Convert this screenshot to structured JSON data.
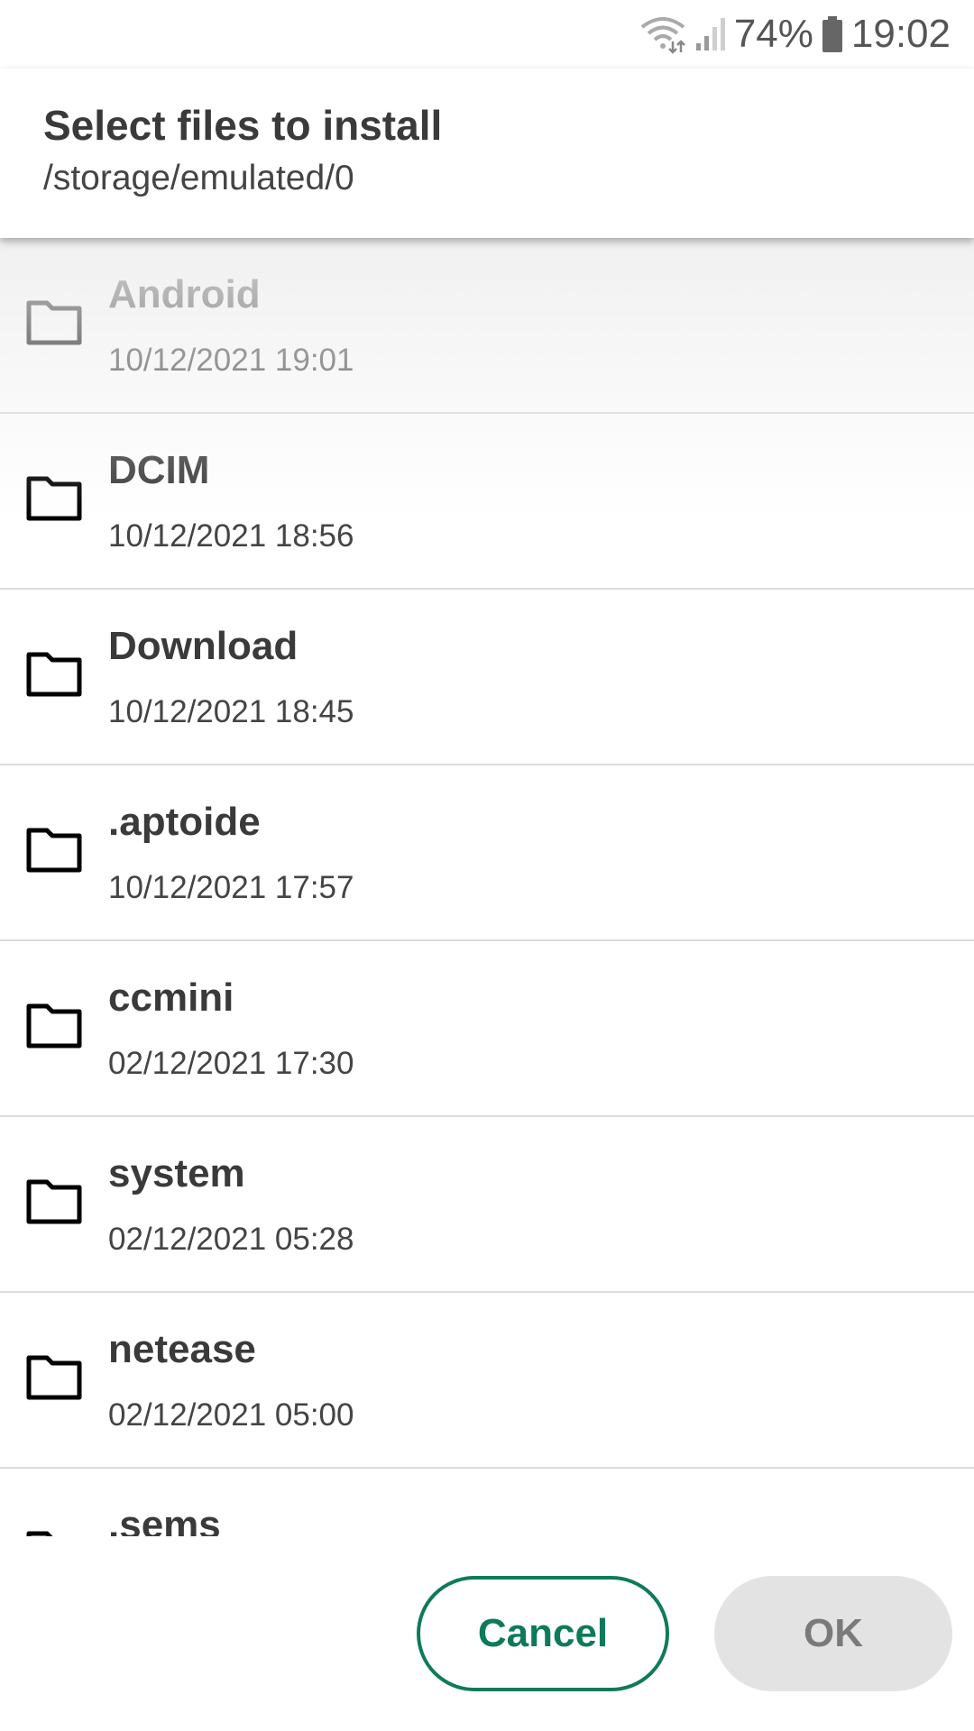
{
  "status_bar": {
    "battery_percent": "74%",
    "time": "19:02",
    "wifi_icon": "wifi-icon",
    "signal_icon": "signal-icon",
    "battery_icon": "battery-icon"
  },
  "dialog": {
    "title": "Select files to install",
    "path": "/storage/emulated/0"
  },
  "files": [
    {
      "name": "Android",
      "date": "10/12/2021 19:01",
      "icon": "folder-icon"
    },
    {
      "name": "DCIM",
      "date": "10/12/2021 18:56",
      "icon": "folder-icon"
    },
    {
      "name": "Download",
      "date": "10/12/2021 18:45",
      "icon": "folder-icon"
    },
    {
      "name": ".aptoide",
      "date": "10/12/2021 17:57",
      "icon": "folder-icon"
    },
    {
      "name": "ccmini",
      "date": "02/12/2021 17:30",
      "icon": "folder-icon"
    },
    {
      "name": "system",
      "date": "02/12/2021 05:28",
      "icon": "folder-icon"
    },
    {
      "name": "netease",
      "date": "02/12/2021 05:00",
      "icon": "folder-icon"
    },
    {
      "name": ".sems",
      "date": "",
      "icon": "folder-icon"
    }
  ],
  "buttons": {
    "cancel_label": "Cancel",
    "ok_label": "OK"
  },
  "colors": {
    "accent": "#0f7a5a",
    "disabled_bg": "#e3e3e3",
    "disabled_text": "#7a7a7a"
  }
}
